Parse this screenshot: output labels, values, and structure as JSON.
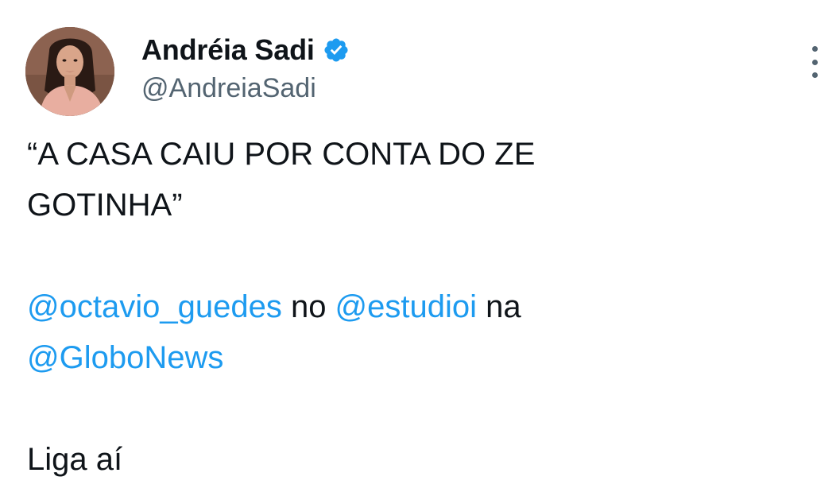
{
  "author": {
    "display_name": "Andréia Sadi",
    "handle": "@AndreiaSadi",
    "verified": true,
    "avatar_icon": "profile-photo"
  },
  "menu": {
    "icon": "more-vertical-icon"
  },
  "tweet": {
    "quote_line_1": "“A CASA CAIU POR CONTA DO ZE",
    "quote_line_2": "GOTINHA”",
    "mention_1": "@octavio_guedes",
    "connector_1": " no ",
    "mention_2": "@estudioi",
    "connector_2": " na",
    "mention_3": "@GloboNews",
    "closing": "Liga aí"
  },
  "colors": {
    "text": "#0f1419",
    "secondary": "#536471",
    "link": "#1d9bf0",
    "verified": "#1d9bf0",
    "background": "#ffffff"
  }
}
